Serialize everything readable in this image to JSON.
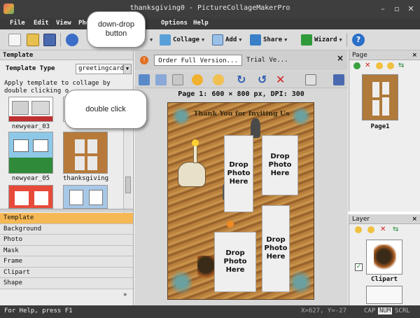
{
  "window": {
    "title": "thanksgiving0 - PictureCollageMakerPro",
    "minimize": "–",
    "restore": "▫",
    "close": "✕"
  },
  "menu": {
    "items": [
      {
        "label": "File"
      },
      {
        "label": "Edit"
      },
      {
        "label": "View"
      },
      {
        "label": "Pho"
      },
      {
        "label": "Options"
      },
      {
        "label": "Help"
      }
    ]
  },
  "toolbar": {
    "collage_label": "Collage",
    "add_label": "Add",
    "share_label": "Share",
    "wizard_label": "Wizard"
  },
  "template_panel": {
    "header": "Template",
    "type_label": "Template Type",
    "type_value": "greetingcard",
    "help_line1": "Apply template to collage by",
    "help_line2": "double clicking o",
    "thumbnails": [
      {
        "label": "newyear_03"
      },
      {
        "label": ""
      },
      {
        "label": "newyear_05"
      },
      {
        "label": "thanksgiving"
      },
      {
        "label": ""
      },
      {
        "label": ""
      }
    ]
  },
  "categories": [
    {
      "label": "Template"
    },
    {
      "label": "Background"
    },
    {
      "label": "Photo"
    },
    {
      "label": "Mask"
    },
    {
      "label": "Frame"
    },
    {
      "label": "Clipart"
    },
    {
      "label": "Shape"
    }
  ],
  "more_label": "»",
  "document": {
    "order_tab": "Order Full Version...",
    "trial_tab": "Trial Ve...",
    "close": "×",
    "page_info": "Page 1: 600 × 800 px, DPI: 300",
    "card_title": "Thank You for Inviting Us",
    "slot_label": "Drop\nPhoto\nHere",
    "slots": [
      {
        "label": "Drop\nPhoto\nHere"
      },
      {
        "label": "Drop\nPhoto\nHere"
      },
      {
        "label": "Drop Photo\nHere"
      },
      {
        "label": "Drop\nPhoto\nHere"
      }
    ]
  },
  "page_panel": {
    "header": "Page",
    "close": "×",
    "thumb_label": "Page1"
  },
  "layer_panel": {
    "header": "Layer",
    "close": "×",
    "layer_label": "Clipart"
  },
  "callouts": {
    "dropdown": "down-drop\nbutton",
    "double_click": "double click"
  },
  "status": {
    "help": "For Help, press F1",
    "coords": "X=627, Y=-27",
    "cap": "CAP",
    "num": "NUM",
    "scrl": "SCRL"
  },
  "icons": {
    "new": "new-file-icon",
    "open": "open-folder-icon",
    "save": "save-icon",
    "undo": "undo-icon",
    "help": "help-icon"
  },
  "colors": {
    "active_category": "#f5b854",
    "title_bar": "#3e3e3e"
  }
}
